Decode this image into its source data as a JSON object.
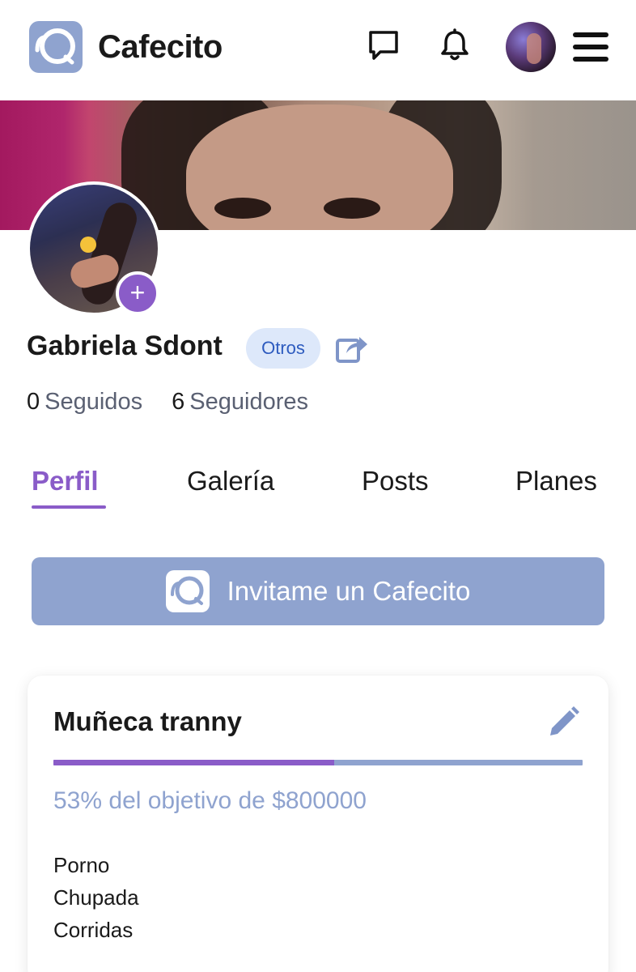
{
  "app": {
    "brand": "Cafecito",
    "accent_color": "#8a5cc8",
    "secondary_color": "#8fa3cf",
    "icons": {
      "logo": "cafecito-logo-icon",
      "chat": "chat-bubble-icon",
      "notifications": "bell-icon",
      "menu": "hamburger-menu-icon",
      "share": "share-icon",
      "edit": "pencil-icon",
      "add": "plus-icon"
    }
  },
  "profile": {
    "name": "Gabriela Sdont",
    "badge": "Otros",
    "add_symbol": "+",
    "stats": [
      {
        "value": "0",
        "label": "Seguidos"
      },
      {
        "value": "6",
        "label": "Seguidores"
      }
    ]
  },
  "tabs": [
    {
      "label": "Perfil",
      "active": true
    },
    {
      "label": "Galería",
      "active": false
    },
    {
      "label": "Posts",
      "active": false
    },
    {
      "label": "Planes",
      "active": false
    }
  ],
  "invite": {
    "label": "Invitame un Cafecito"
  },
  "goal": {
    "title": "Muñeca tranny",
    "progress_fraction": 0.53,
    "progress_text": "53% del objetivo de $800000",
    "description": [
      "Porno",
      "Chupada",
      "Corridas"
    ]
  }
}
